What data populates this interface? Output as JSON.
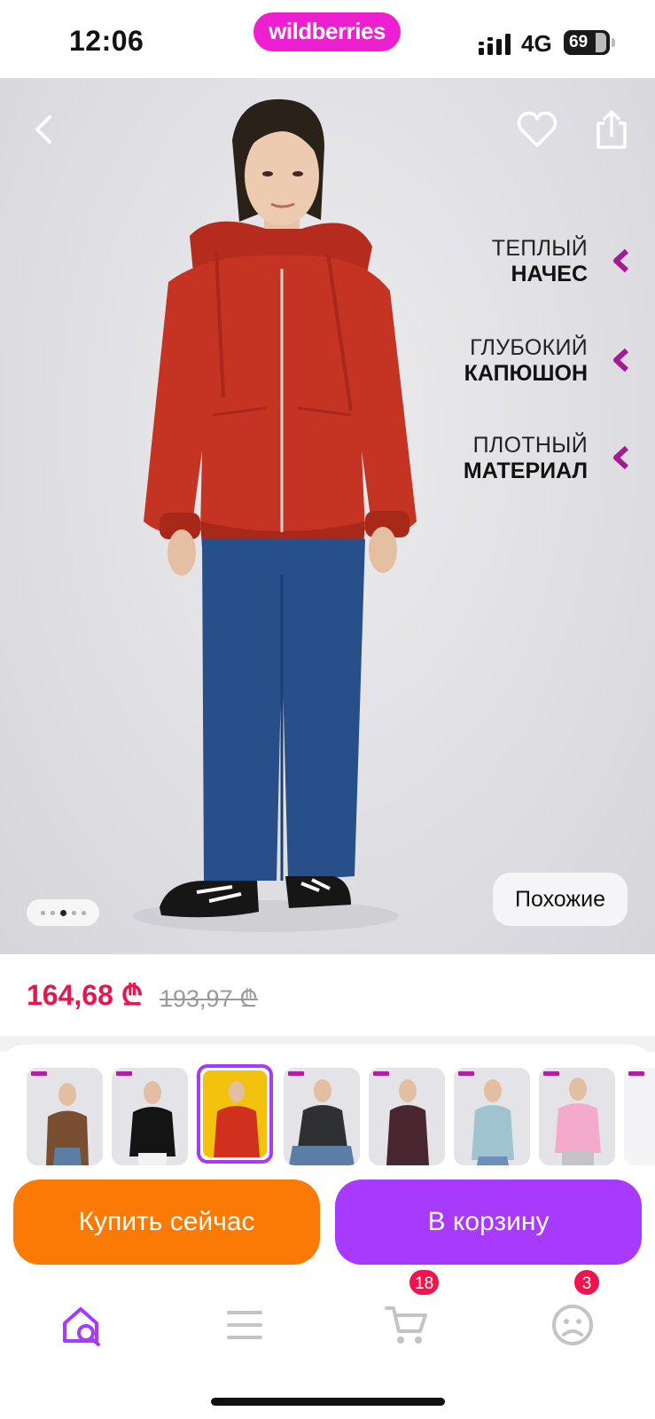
{
  "status_bar": {
    "time": "12:06",
    "network": "4G",
    "battery": "69"
  },
  "brand": {
    "logo_text": "wildberries",
    "color": "#ee1fd0"
  },
  "hero": {
    "features": [
      {
        "line1": "ТЕПЛЫЙ",
        "line2": "НАЧЕС"
      },
      {
        "line1": "ГЛУБОКИЙ",
        "line2": "КАПЮШОН"
      },
      {
        "line1": "ПЛОТНЫЙ",
        "line2": "МАТЕРИАЛ"
      }
    ],
    "similar_label": "Похожие",
    "gallery_pages": 5,
    "gallery_active_index": 3
  },
  "price": {
    "current": "164,68 ₾",
    "old": "193,97 ₾",
    "current_color": "#e6164e"
  },
  "variants": {
    "items": [
      {
        "color": "brown",
        "selected": false
      },
      {
        "color": "black",
        "selected": false
      },
      {
        "color": "red",
        "selected": true
      },
      {
        "color": "dark-gray",
        "selected": false
      },
      {
        "color": "plum",
        "selected": false
      },
      {
        "color": "light-blue",
        "selected": false
      },
      {
        "color": "pink",
        "selected": false
      },
      {
        "color": "white",
        "selected": false
      }
    ],
    "selected_border_color": "#a73afd"
  },
  "actions": {
    "buy_now_label": "Купить сейчас",
    "add_to_cart_label": "В корзину",
    "buy_color": "#fb7a06",
    "cart_color": "#a73afd"
  },
  "tabbar": {
    "items": [
      {
        "icon": "home-search-icon",
        "active": true
      },
      {
        "icon": "menu-icon",
        "active": false
      },
      {
        "icon": "cart-icon",
        "badge": "18"
      },
      {
        "icon": "profile-icon",
        "badge": "3"
      }
    ]
  }
}
